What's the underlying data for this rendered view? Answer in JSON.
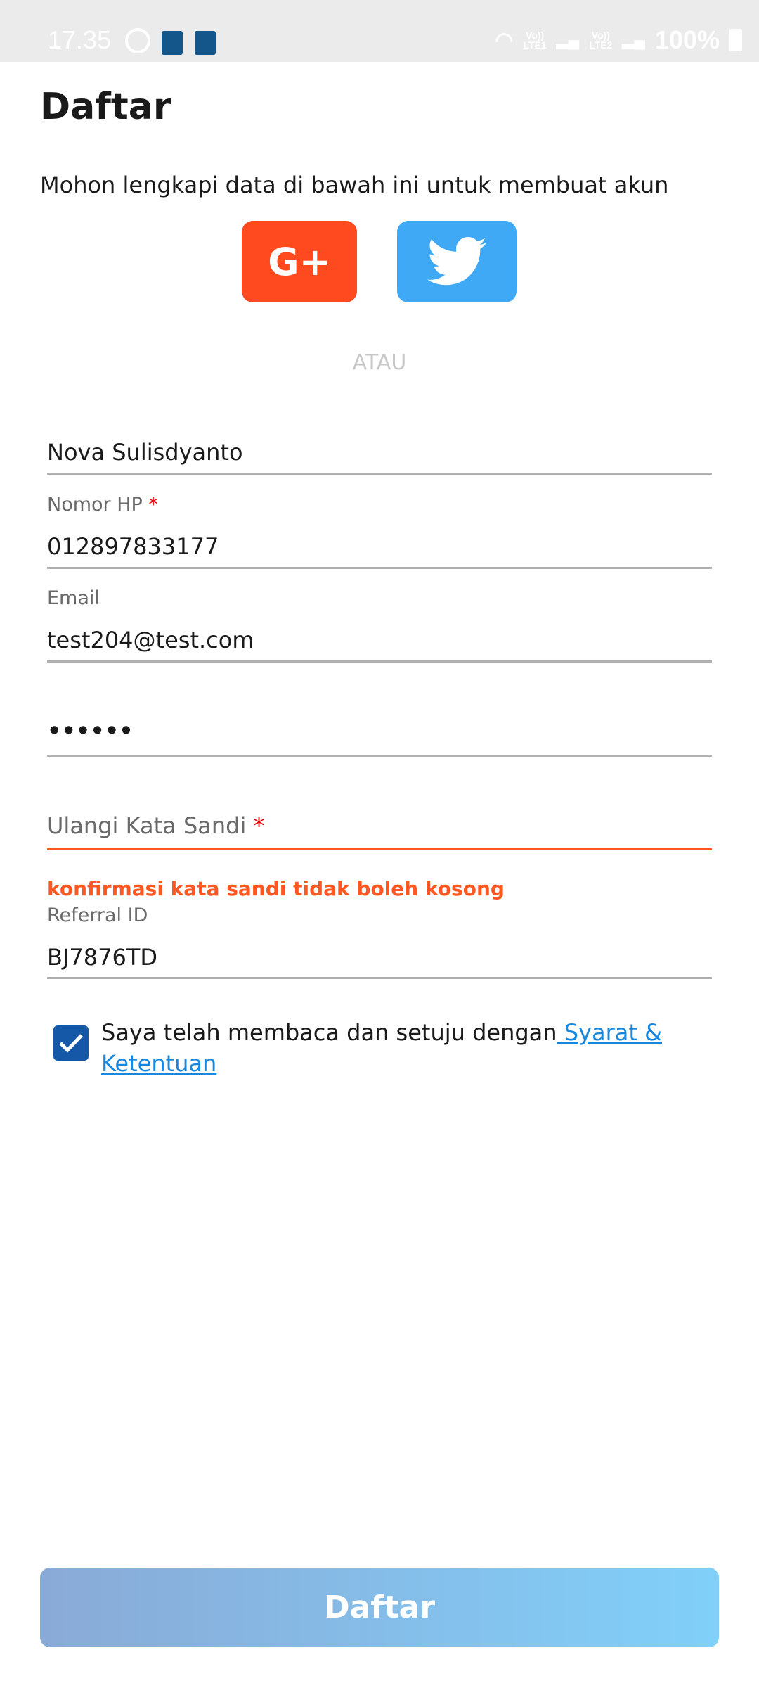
{
  "status_bar": {
    "time": "17.35",
    "lte1": "LTE1",
    "lte2": "LTE2",
    "volte": "Vo))",
    "battery": "100%"
  },
  "page": {
    "title": "Daftar",
    "subtitle": "Mohon lengkapi data di bawah ini untuk membuat akun",
    "or": "ATAU"
  },
  "social": {
    "google_label": "G+",
    "google_color": "#ff4a1f",
    "twitter_color": "#3fa9f5"
  },
  "form": {
    "name": {
      "value": "Nova Sulisdyanto"
    },
    "phone": {
      "label": "Nomor HP",
      "required": "*",
      "value": "012897833177"
    },
    "email": {
      "label": "Email",
      "value": "test204@test.com"
    },
    "password": {
      "value": "••••••"
    },
    "confirm": {
      "placeholder": "Ulangi Kata Sandi",
      "required": "*",
      "error": "konfirmasi kata sandi tidak boleh kosong",
      "error_color": "#ff5722"
    },
    "referral": {
      "label": "Referral ID",
      "value": "BJ7876TD"
    }
  },
  "agree": {
    "checked": true,
    "text": "Saya telah membaca dan setuju dengan",
    "link": " Syarat & Ketentuan"
  },
  "submit": {
    "label": "Daftar"
  }
}
